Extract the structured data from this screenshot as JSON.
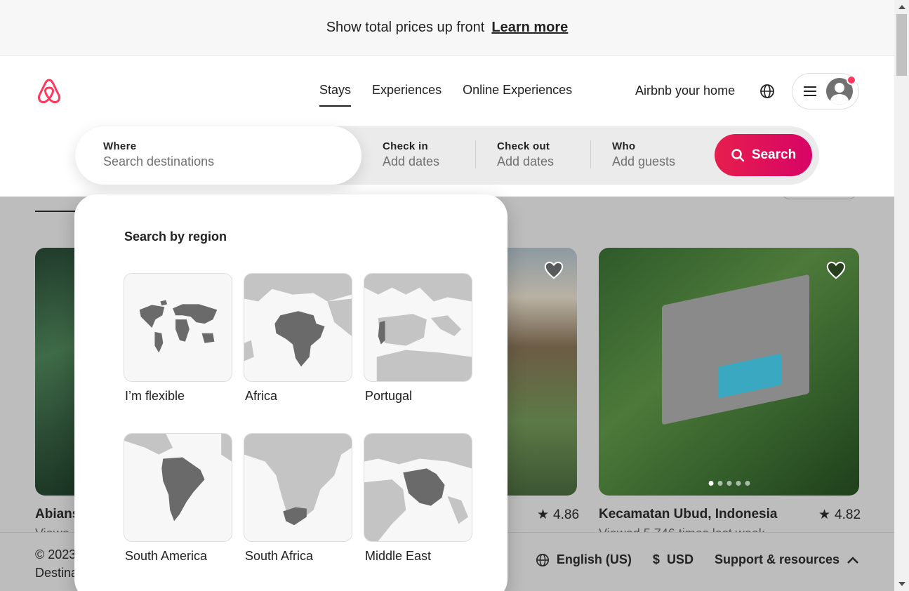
{
  "banner": {
    "text": "Show total prices up front",
    "link": "Learn more"
  },
  "header": {
    "nav": [
      "Stays",
      "Experiences",
      "Online Experiences"
    ],
    "host_link": "Airbnb your home",
    "brand_color": "#ff385c"
  },
  "search": {
    "where_label": "Where",
    "where_placeholder": "Search destinations",
    "checkin_label": "Check in",
    "checkin_value": "Add dates",
    "checkout_label": "Check out",
    "checkout_value": "Add dates",
    "who_label": "Who",
    "who_value": "Add guests",
    "button_label": "Search"
  },
  "dropdown": {
    "title": "Search by region",
    "regions": [
      "I’m flexible",
      "Africa",
      "Portugal",
      "South America",
      "South Africa",
      "Middle East"
    ]
  },
  "listings": [
    {
      "title": "Abians",
      "sub": "Viewe",
      "rating": ""
    },
    {
      "title": "",
      "sub": "",
      "rating": "4.86"
    },
    {
      "title": "Kecamatan Ubud, Indonesia",
      "sub": "Viewed 5,746 times last week",
      "rating": "4.82"
    }
  ],
  "footer": {
    "copyright": "© 2023",
    "destinations": "Destina",
    "language": "English (US)",
    "currency_symbol": "$",
    "currency": "USD",
    "support": "Support & resources"
  }
}
